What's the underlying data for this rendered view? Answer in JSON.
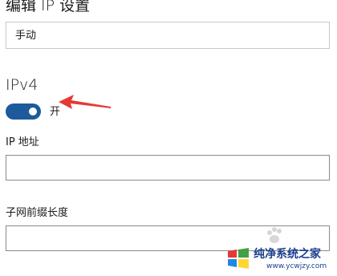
{
  "header": {
    "title": "编辑 IP 设置"
  },
  "mode_select": {
    "value": "手动"
  },
  "ipv4": {
    "title": "IPv4",
    "toggle_state": "on",
    "toggle_label": "开"
  },
  "fields": {
    "ip_address_label": "IP 地址",
    "ip_address_value": "",
    "subnet_prefix_label": "子网前缀长度",
    "subnet_prefix_value": ""
  },
  "watermark": {
    "text": "纯净系统之家",
    "url": "www.ycwjzy.com"
  },
  "colors": {
    "toggle_on": "#1c5a9c",
    "arrow": "#e53935",
    "watermark_text": "#1b3f8f"
  },
  "icons": {
    "arrow": "red-arrow-icon",
    "watermark_logo": "windows-logo-icon"
  }
}
